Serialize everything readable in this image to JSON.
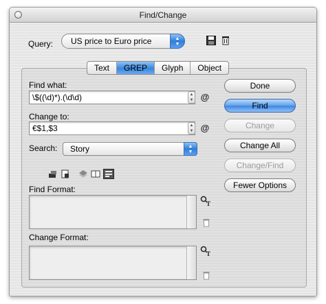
{
  "window": {
    "title": "Find/Change"
  },
  "query": {
    "label": "Query:",
    "selected": "US price to Euro price"
  },
  "tabs": [
    {
      "label": "Text",
      "active": false
    },
    {
      "label": "GREP",
      "active": true
    },
    {
      "label": "Glyph",
      "active": false
    },
    {
      "label": "Object",
      "active": false
    }
  ],
  "find": {
    "label": "Find what:",
    "value": "\\$((\\d)*).(\\d\\d)"
  },
  "change": {
    "label": "Change to:",
    "value": "€$1,$3"
  },
  "search": {
    "label": "Search:",
    "selected": "Story"
  },
  "find_format": {
    "label": "Find Format:"
  },
  "change_format": {
    "label": "Change Format:"
  },
  "buttons": {
    "done": "Done",
    "find": "Find",
    "change": "Change",
    "change_all": "Change All",
    "change_find": "Change/Find",
    "fewer_options": "Fewer Options"
  },
  "colors": {
    "accent": "#3d86e3",
    "disabled_text": "#9c9c9c"
  }
}
